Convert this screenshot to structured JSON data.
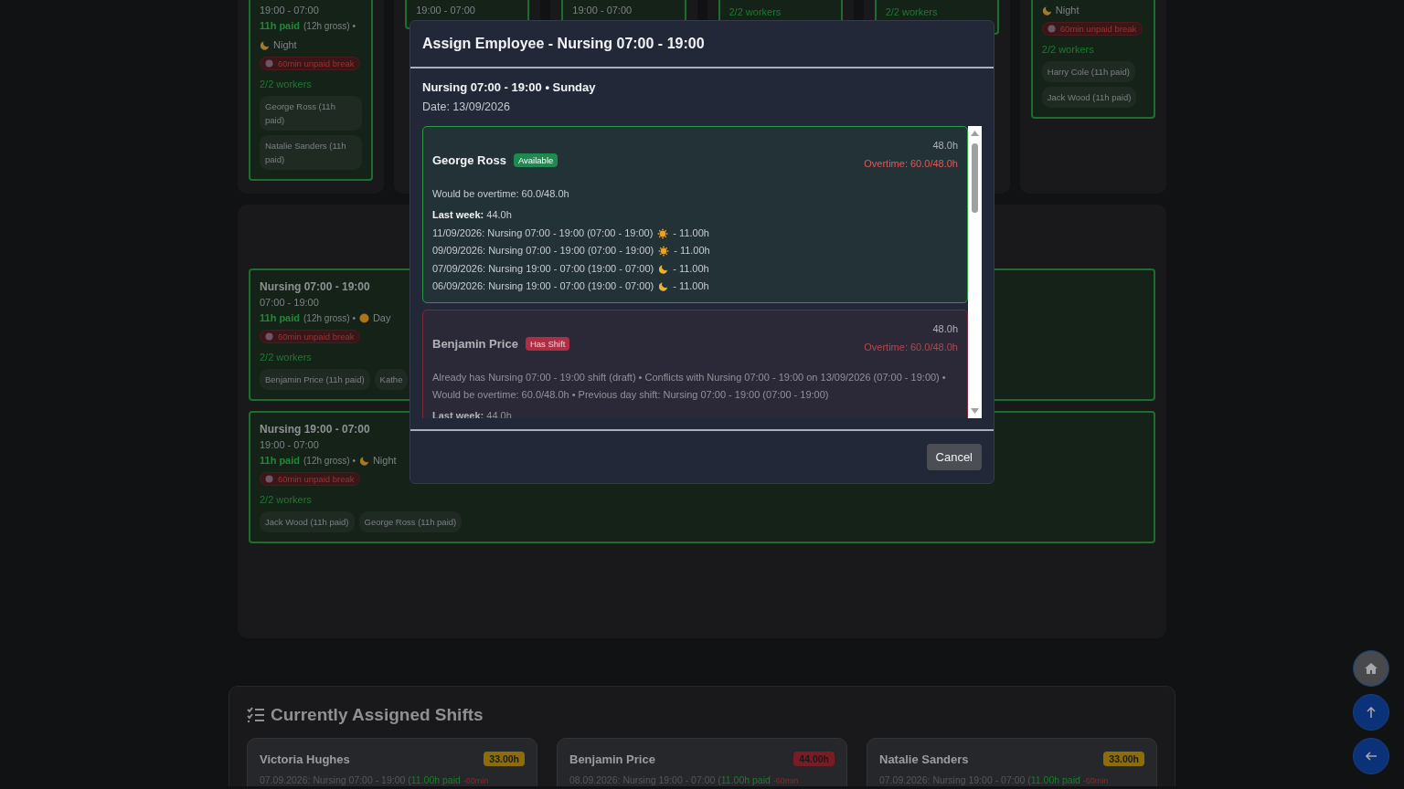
{
  "schedule_columns": [
    {
      "shift": {
        "time": "19:00 - 07:00",
        "paid": "11h paid",
        "gross": "(12h gross) •",
        "period": {
          "kind": "night",
          "label": "Night"
        },
        "break": "60min unpaid break",
        "workers": "2/2 workers",
        "chips": [
          "George Ross (11h paid)",
          "Natalie Sanders (11h paid)"
        ]
      }
    },
    {
      "shift": {
        "time": "19:00 - 07:00"
      }
    },
    {
      "shift": {
        "time": "19:00 - 07:00"
      }
    },
    {
      "shift": {
        "workers": "2/2 workers"
      }
    },
    {
      "shift": {
        "workers": "2/2 workers"
      }
    },
    {
      "shift": {
        "period": {
          "kind": "night",
          "label": "Night"
        },
        "break": "60min unpaid break",
        "workers": "2/2 workers",
        "chips": [
          "Harry Cole (11h paid)",
          "Jack Wood (11h paid)"
        ]
      }
    }
  ],
  "day_shifts": [
    {
      "title": "Nursing 07:00 - 19:00",
      "time": "07:00 - 19:00",
      "paid": "11h paid",
      "gross": "(12h gross) •",
      "period": {
        "kind": "day",
        "label": "Day"
      },
      "break": "60min unpaid break",
      "workers": "2/2 workers",
      "chips": [
        "Benjamin Price (11h paid)",
        "Kathe"
      ]
    },
    {
      "title": "Nursing 19:00 - 07:00",
      "time": "19:00 - 07:00",
      "paid": "11h paid",
      "gross": "(12h gross) •",
      "period": {
        "kind": "night",
        "label": "Night"
      },
      "break": "60min unpaid break",
      "workers": "2/2 workers",
      "chips": [
        "Jack Wood (11h paid)",
        "George Ross (11h paid)"
      ]
    }
  ],
  "assigned": {
    "title": "Currently Assigned Shifts",
    "cards": [
      {
        "name": "Victoria Hughes",
        "hours": "33.00h",
        "color": "#8c6d08",
        "shift": "07.09.2026: Nursing 07:00 - 19:00 (",
        "paid": "11.00h paid",
        "break": "-60min"
      },
      {
        "name": "Benjamin Price",
        "hours": "44.00h",
        "color": "#7a1c26",
        "shift": "08.09.2026: Nursing 19:00 - 07:00 (",
        "paid": "11.00h paid",
        "break": "-60min"
      },
      {
        "name": "Natalie Sanders",
        "hours": "33.00h",
        "color": "#8c6d08",
        "shift": "07.09.2026: Nursing 19:00 - 07:00 (",
        "paid": "11.00h paid",
        "break": "-60min"
      }
    ]
  },
  "floating_buttons": [
    {
      "kind": "home"
    },
    {
      "kind": "up"
    },
    {
      "kind": "back"
    }
  ],
  "modal": {
    "title": "Assign Employee - Nursing 07:00 - 19:00",
    "subtitle": "Nursing 07:00 - 19:00 • Sunday",
    "date": "Date: 13/09/2026",
    "employees": [
      {
        "name": "George Ross",
        "kind": "available",
        "badge": "Available",
        "hours": "48.0h",
        "overtime": "Overtime: 60.0/48.0h",
        "notes": "Would be overtime: 60.0/48.0h",
        "last_week": "**Last week:** 44.0h",
        "history": [
          {
            "text": "11/09/2026: Nursing 07:00 - 19:00 (07:00 - 19:00)",
            "kind": "day",
            "hours": "- 11.00h"
          },
          {
            "text": "09/09/2026: Nursing 07:00 - 19:00 (07:00 - 19:00)",
            "kind": "day",
            "hours": "- 11.00h"
          },
          {
            "text": "07/09/2026: Nursing 19:00 - 07:00 (19:00 - 07:00)",
            "kind": "night",
            "hours": "- 11.00h"
          },
          {
            "text": "06/09/2026: Nursing 19:00 - 07:00 (19:00 - 07:00)",
            "kind": "night",
            "hours": "- 11.00h"
          }
        ]
      },
      {
        "name": "Benjamin Price",
        "kind": "conflict",
        "badge": "Has Shift",
        "hours": "48.0h",
        "overtime": "Overtime: 60.0/48.0h",
        "notes": "Already has Nursing 07:00 - 19:00 shift (draft) • Conflicts with Nursing 07:00 - 19:00 on 13/09/2026 (07:00 - 19:00) • Would be overtime: 60.0/48.0h • Previous day shift: Nursing 07:00 - 19:00 (07:00 - 19:00)",
        "last_week": "**Last week:** 44.0h"
      }
    ],
    "cancel": "Cancel"
  }
}
